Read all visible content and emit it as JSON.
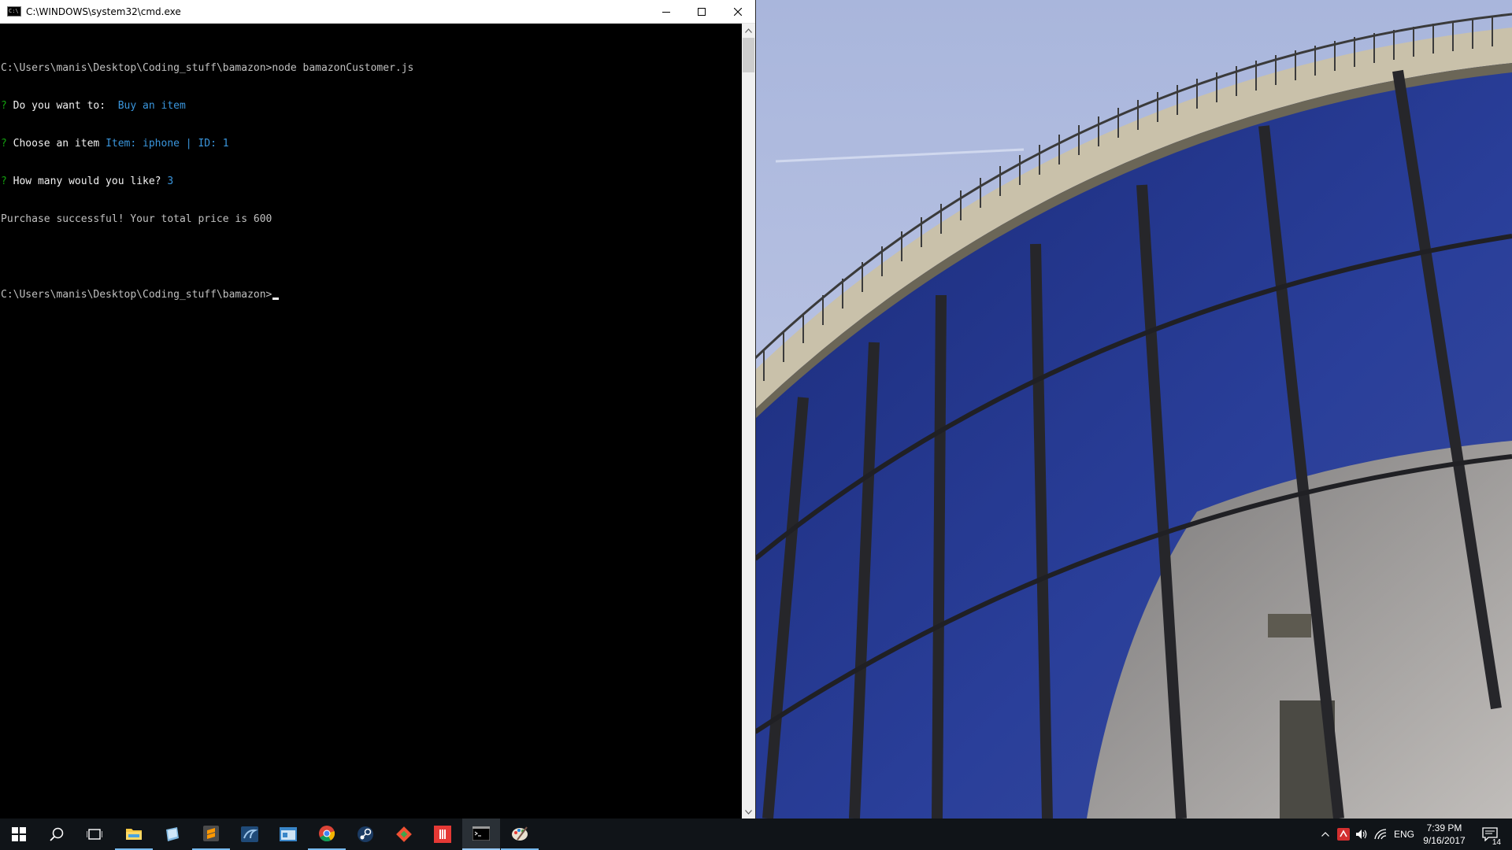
{
  "window": {
    "title": "C:\\WINDOWS\\system32\\cmd.exe",
    "icon_text": "C:\\"
  },
  "console": {
    "prompt_path": "C:\\Users\\manis\\Desktop\\Coding_stuff\\bamazon>",
    "command": "node bamazonCustomer.js",
    "q1_mark": "?",
    "q1_label": "Do you want to: ",
    "q1_answer": " Buy an item",
    "q2_mark": "?",
    "q2_label": "Choose an item ",
    "q2_answer": "Item: iphone | ID: 1",
    "q3_mark": "?",
    "q3_label": "How many would you like? ",
    "q3_answer": "3",
    "result": "Purchase successful! Your total price is 600",
    "final_prompt": "C:\\Users\\manis\\Desktop\\Coding_stuff\\bamazon>"
  },
  "taskbar": {
    "items": [
      {
        "name": "start-button",
        "icon": "windows-logo-icon"
      },
      {
        "name": "search-button",
        "icon": "search-icon"
      },
      {
        "name": "task-view-button",
        "icon": "task-view-icon"
      },
      {
        "name": "file-explorer",
        "icon": "folder-icon",
        "running": true
      },
      {
        "name": "app-notebook",
        "icon": "notebook-icon"
      },
      {
        "name": "sublime-text",
        "icon": "sublime-icon",
        "running": true
      },
      {
        "name": "mysql-workbench",
        "icon": "dolphin-icon"
      },
      {
        "name": "app-window",
        "icon": "window-app-icon"
      },
      {
        "name": "chrome",
        "icon": "chrome-icon",
        "running": true
      },
      {
        "name": "steam",
        "icon": "steam-icon"
      },
      {
        "name": "git",
        "icon": "git-icon"
      },
      {
        "name": "app-red",
        "icon": "red-app-icon"
      },
      {
        "name": "command-prompt",
        "icon": "cmd-icon",
        "running": true,
        "active": true
      },
      {
        "name": "app-paint",
        "icon": "palette-icon",
        "running": true
      }
    ],
    "tray": {
      "language": "ENG",
      "time": "7:39 PM",
      "date": "9/16/2017",
      "notification_count": "14"
    }
  },
  "colors": {
    "console_bg": "#000000",
    "console_text": "#c0c0c0",
    "prompt_mark": "#13a10e",
    "answer": "#3a96dd",
    "taskbar_bg": "#101418"
  }
}
